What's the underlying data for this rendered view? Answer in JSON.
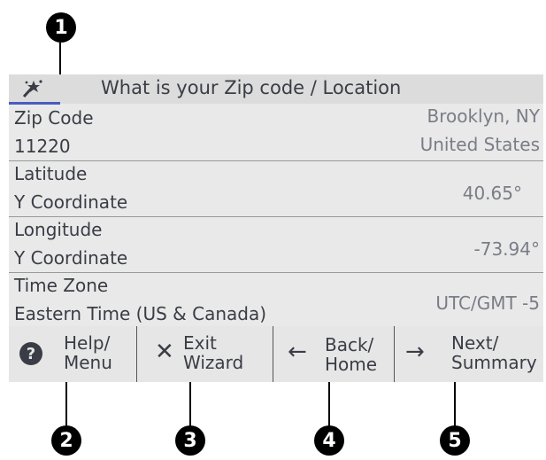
{
  "callouts": [
    "1",
    "2",
    "3",
    "4",
    "5"
  ],
  "titlebar": {
    "icon": "magic-wand-icon",
    "title": "What is your Zip code / Location"
  },
  "rows": [
    {
      "label1": "Zip Code",
      "label2": "11220",
      "value1": "Brooklyn, NY",
      "value2": "United States"
    },
    {
      "label1": "Latitude",
      "label2": "Y Coordinate",
      "value": "40.65°"
    },
    {
      "label1": "Longitude",
      "label2": "Y Coordinate",
      "value": "-73.94°"
    },
    {
      "label1": "Time Zone",
      "label2": "Eastern Time (US & Canada)",
      "value": "UTC/GMT -5"
    }
  ],
  "buttons": [
    {
      "icon": "help-icon",
      "glyph": "?",
      "line1": "Help/",
      "line2": "Menu"
    },
    {
      "icon": "close-icon",
      "glyph": "✕",
      "line1": "Exit",
      "line2": "Wizard"
    },
    {
      "icon": "arrow-left-icon",
      "glyph": "←",
      "line1": "Back/",
      "line2": "Home"
    },
    {
      "icon": "arrow-right-icon",
      "glyph": "→",
      "line1": "Next/",
      "line2": "Summary"
    }
  ],
  "colors": {
    "screen_bg": "#e9e9e9",
    "accent_underline": "#4a5bbf",
    "value_text": "#7a7d86"
  }
}
